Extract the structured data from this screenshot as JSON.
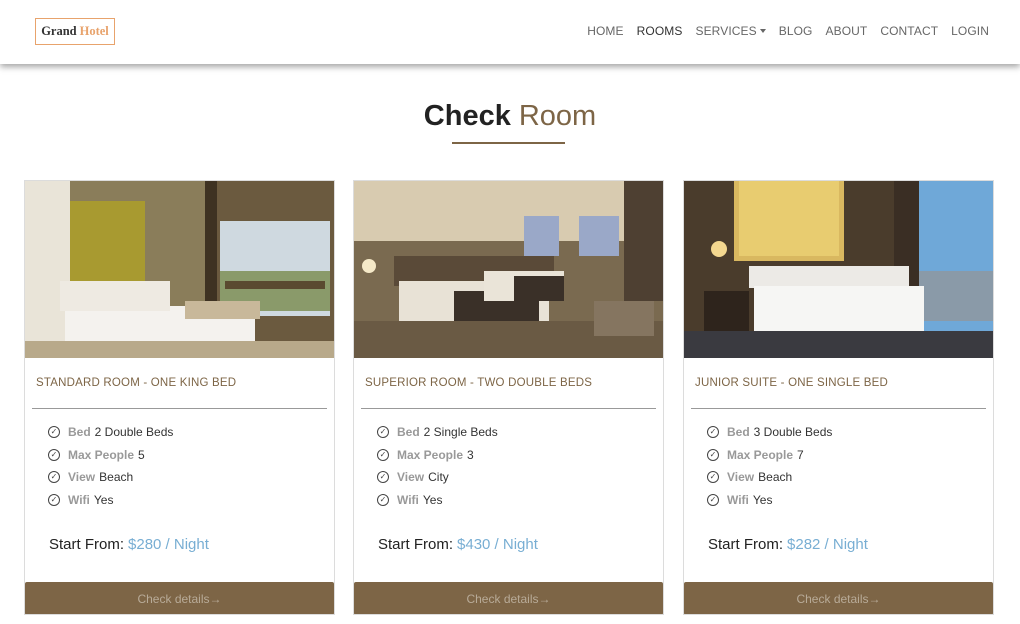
{
  "brand": {
    "part1": "Grand",
    "part2": "Hotel"
  },
  "nav": {
    "home": "HOME",
    "rooms": "ROOMS",
    "services": "SERVICES",
    "blog": "BLOG",
    "about": "ABOUT",
    "contact": "CONTACT",
    "login": "LOGIN"
  },
  "heading": {
    "part1": "Check",
    "part2": "Room"
  },
  "labels": {
    "bed": "Bed",
    "max_people": "Max People",
    "view": "View",
    "wifi": "Wifi",
    "start_from": "Start From:",
    "details": "Check details→"
  },
  "rooms": [
    {
      "name": "STANDARD ROOM - ONE KING BED",
      "bed": "2 Double Beds",
      "max_people": "5",
      "view": "Beach",
      "wifi": "Yes",
      "price": "$280 / Night"
    },
    {
      "name": "SUPERIOR ROOM - TWO DOUBLE BEDS",
      "bed": "2 Single Beds",
      "max_people": "3",
      "view": "City",
      "wifi": "Yes",
      "price": "$430 / Night"
    },
    {
      "name": "JUNIOR SUITE - ONE SINGLE BED",
      "bed": "3 Double Beds",
      "max_people": "7",
      "view": "Beach",
      "wifi": "Yes",
      "price": "$282 / Night"
    }
  ],
  "colors": {
    "accent": "#7d6546",
    "price": "#78aed3",
    "brand_accent": "#e8a36c"
  }
}
